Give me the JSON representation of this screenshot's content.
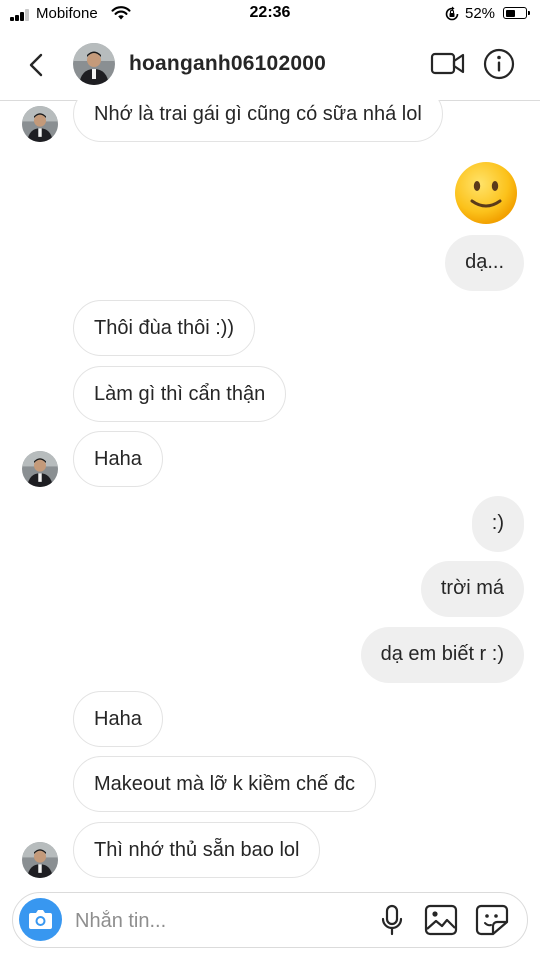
{
  "status_bar": {
    "carrier": "Mobifone",
    "time": "22:36",
    "battery_percent": "52%",
    "battery_level": 0.52,
    "signal_bars": 3
  },
  "header": {
    "username": "hoanganh06102000",
    "icons": [
      "back-icon",
      "avatar",
      "video-call-icon",
      "info-icon"
    ]
  },
  "messages": [
    {
      "side": "in",
      "text": "Nhớ là trai gái gì cũng có sữa nhá lol",
      "avatar": true
    },
    {
      "side": "out",
      "type": "emoji",
      "emoji": "🙂"
    },
    {
      "side": "out",
      "text": "dạ..."
    },
    {
      "side": "in",
      "text": "Thôi đùa thôi :))"
    },
    {
      "side": "in",
      "text": "Làm gì thì cẩn thận"
    },
    {
      "side": "in",
      "text": "Haha",
      "avatar": true
    },
    {
      "side": "out",
      "text": ":)"
    },
    {
      "side": "out",
      "text": "trời má"
    },
    {
      "side": "out",
      "text": "dạ em biết r :)"
    },
    {
      "side": "in",
      "text": "Haha"
    },
    {
      "side": "in",
      "text": "Makeout mà lỡ k kiềm chế đc"
    },
    {
      "side": "in",
      "text": "Thì nhớ thủ sẵn bao lol",
      "avatar": true
    }
  ],
  "composer": {
    "placeholder": "Nhắn tin...",
    "icons": [
      "camera-icon",
      "microphone-icon",
      "gallery-icon",
      "sticker-icon"
    ]
  },
  "colors": {
    "accent": "#3897f0",
    "outgoing_bubble": "#efefef",
    "incoming_border": "#e3e3e3",
    "text": "#262626",
    "placeholder": "#8e8e8e"
  }
}
